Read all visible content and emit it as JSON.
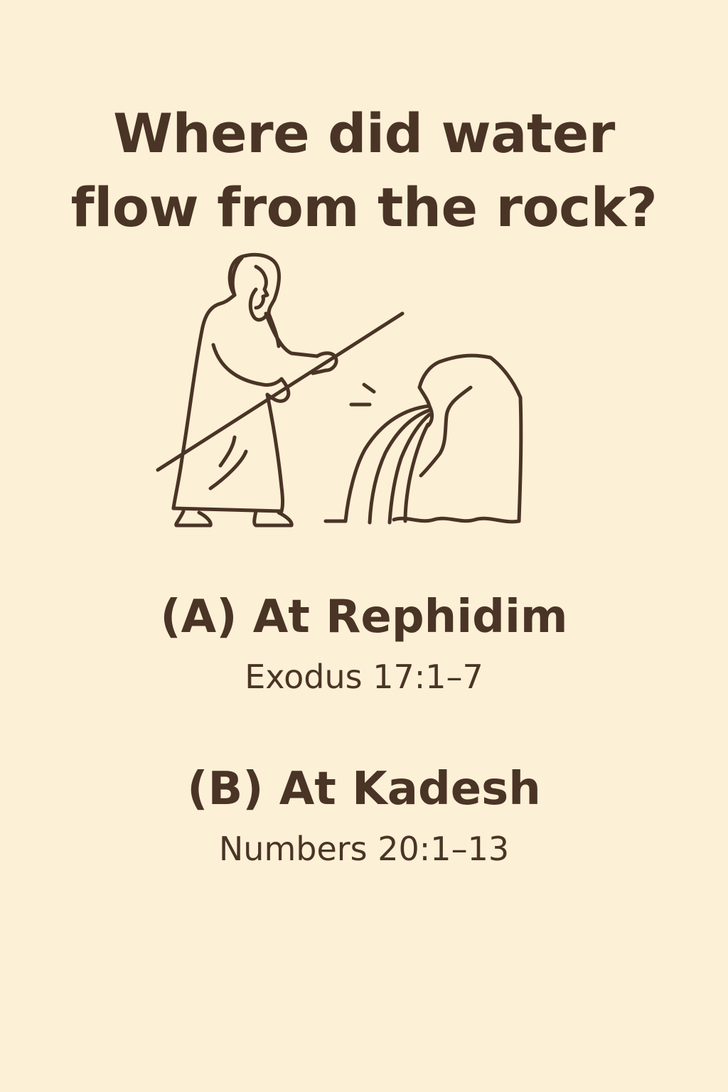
{
  "question": {
    "line1": "Where did water",
    "line2": "flow from the rock?"
  },
  "illustration": {
    "icon": "moses-striking-rock-icon",
    "stroke_color": "#4a3426"
  },
  "options": [
    {
      "title": "(A) At Rephidim",
      "reference": "Exodus 17:1–7"
    },
    {
      "title": "(B) At Kadesh",
      "reference": "Numbers 20:1–13"
    }
  ],
  "colors": {
    "background": "#fcf0d6",
    "text": "#4a3426"
  }
}
